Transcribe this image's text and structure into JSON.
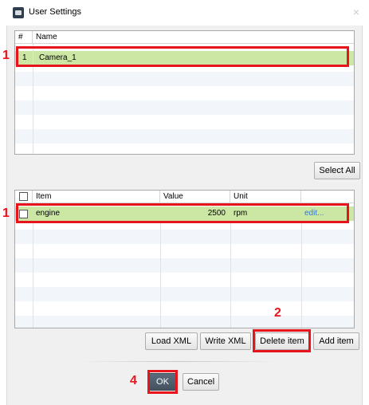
{
  "window": {
    "title": "User Settings",
    "close_glyph": "×"
  },
  "top_table": {
    "columns": [
      "#",
      "Name"
    ],
    "rows": [
      {
        "index": "1",
        "name": "Camera_1",
        "selected": true
      }
    ],
    "select_all_label": "Select All"
  },
  "bottom_table": {
    "columns": [
      "",
      "Item",
      "Value",
      "Unit",
      ""
    ],
    "rows": [
      {
        "checked": false,
        "item": "engine",
        "value": "2500",
        "unit": "rpm",
        "action": "edit...",
        "selected": true
      }
    ]
  },
  "buttons": {
    "load_xml": "Load XML",
    "write_xml": "Write XML",
    "delete_item": "Delete item",
    "add_item": "Add item",
    "ok": "OK",
    "cancel": "Cancel"
  },
  "annotations": {
    "marker_top_row": "1",
    "marker_bottom_row": "1",
    "marker_delete": "2",
    "marker_ok": "4"
  },
  "colors": {
    "selected_row": "#cbe7a3",
    "annotation_red": "#e8141b",
    "link": "#3a78c4"
  }
}
